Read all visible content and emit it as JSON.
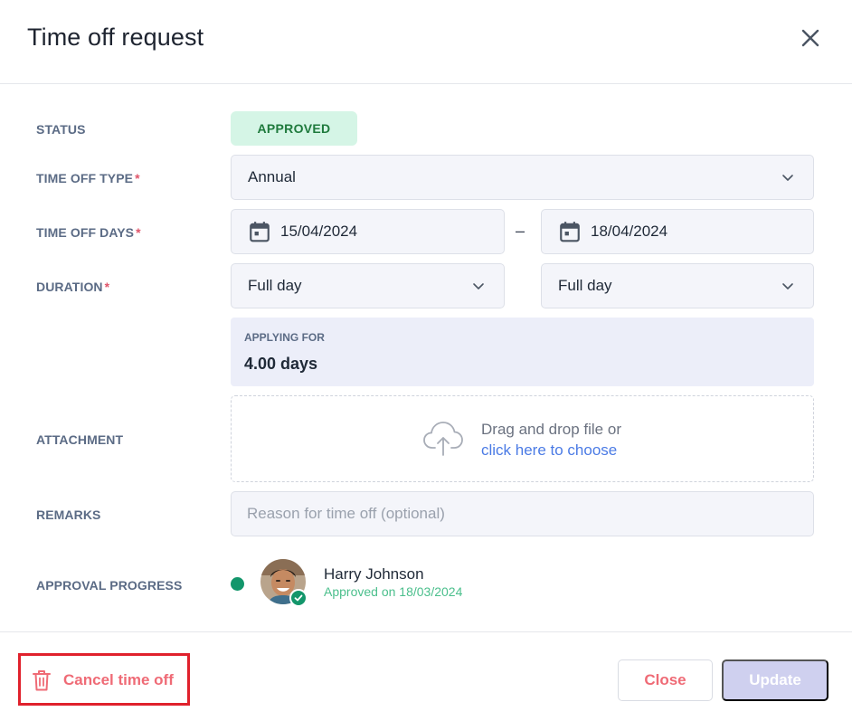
{
  "dialog": {
    "title": "Time off request"
  },
  "form": {
    "status": {
      "label": "STATUS",
      "value": "APPROVED",
      "color": "#1f7a3d",
      "bg": "#d5f5e6"
    },
    "type": {
      "label": "TIME OFF TYPE",
      "required": "*",
      "value": "Annual"
    },
    "days": {
      "label": "TIME OFF DAYS",
      "required": "*",
      "start": "15/04/2024",
      "separator": "–",
      "end": "18/04/2024"
    },
    "duration": {
      "label": "DURATION",
      "required": "*",
      "start": "Full day",
      "end": "Full day"
    },
    "applying": {
      "label": "APPLYING FOR",
      "value": "4.00 days"
    },
    "attachment": {
      "label": "ATTACHMENT",
      "hint": "Drag and drop file or",
      "link": "click here to choose"
    },
    "remarks": {
      "label": "REMARKS",
      "placeholder": "Reason for time off (optional)"
    },
    "approval": {
      "label": "APPROVAL PROGRESS",
      "approver": "Harry Johnson",
      "status": "Approved on 18/03/2024"
    }
  },
  "footer": {
    "cancel_label": "Cancel time off",
    "close_label": "Close",
    "update_label": "Update"
  },
  "icons": {
    "close": "close-icon",
    "calendar": "calendar-icon",
    "chevron": "chevron-down-icon",
    "upload": "cloud-upload-icon",
    "trash": "trash-icon",
    "check": "check-icon"
  },
  "colors": {
    "accent_danger": "#ef6b76",
    "highlight_box": "#e0212c",
    "approved_green": "#13966b",
    "link_blue": "#4b7be5",
    "update_disabled": "#cfd0ef"
  }
}
